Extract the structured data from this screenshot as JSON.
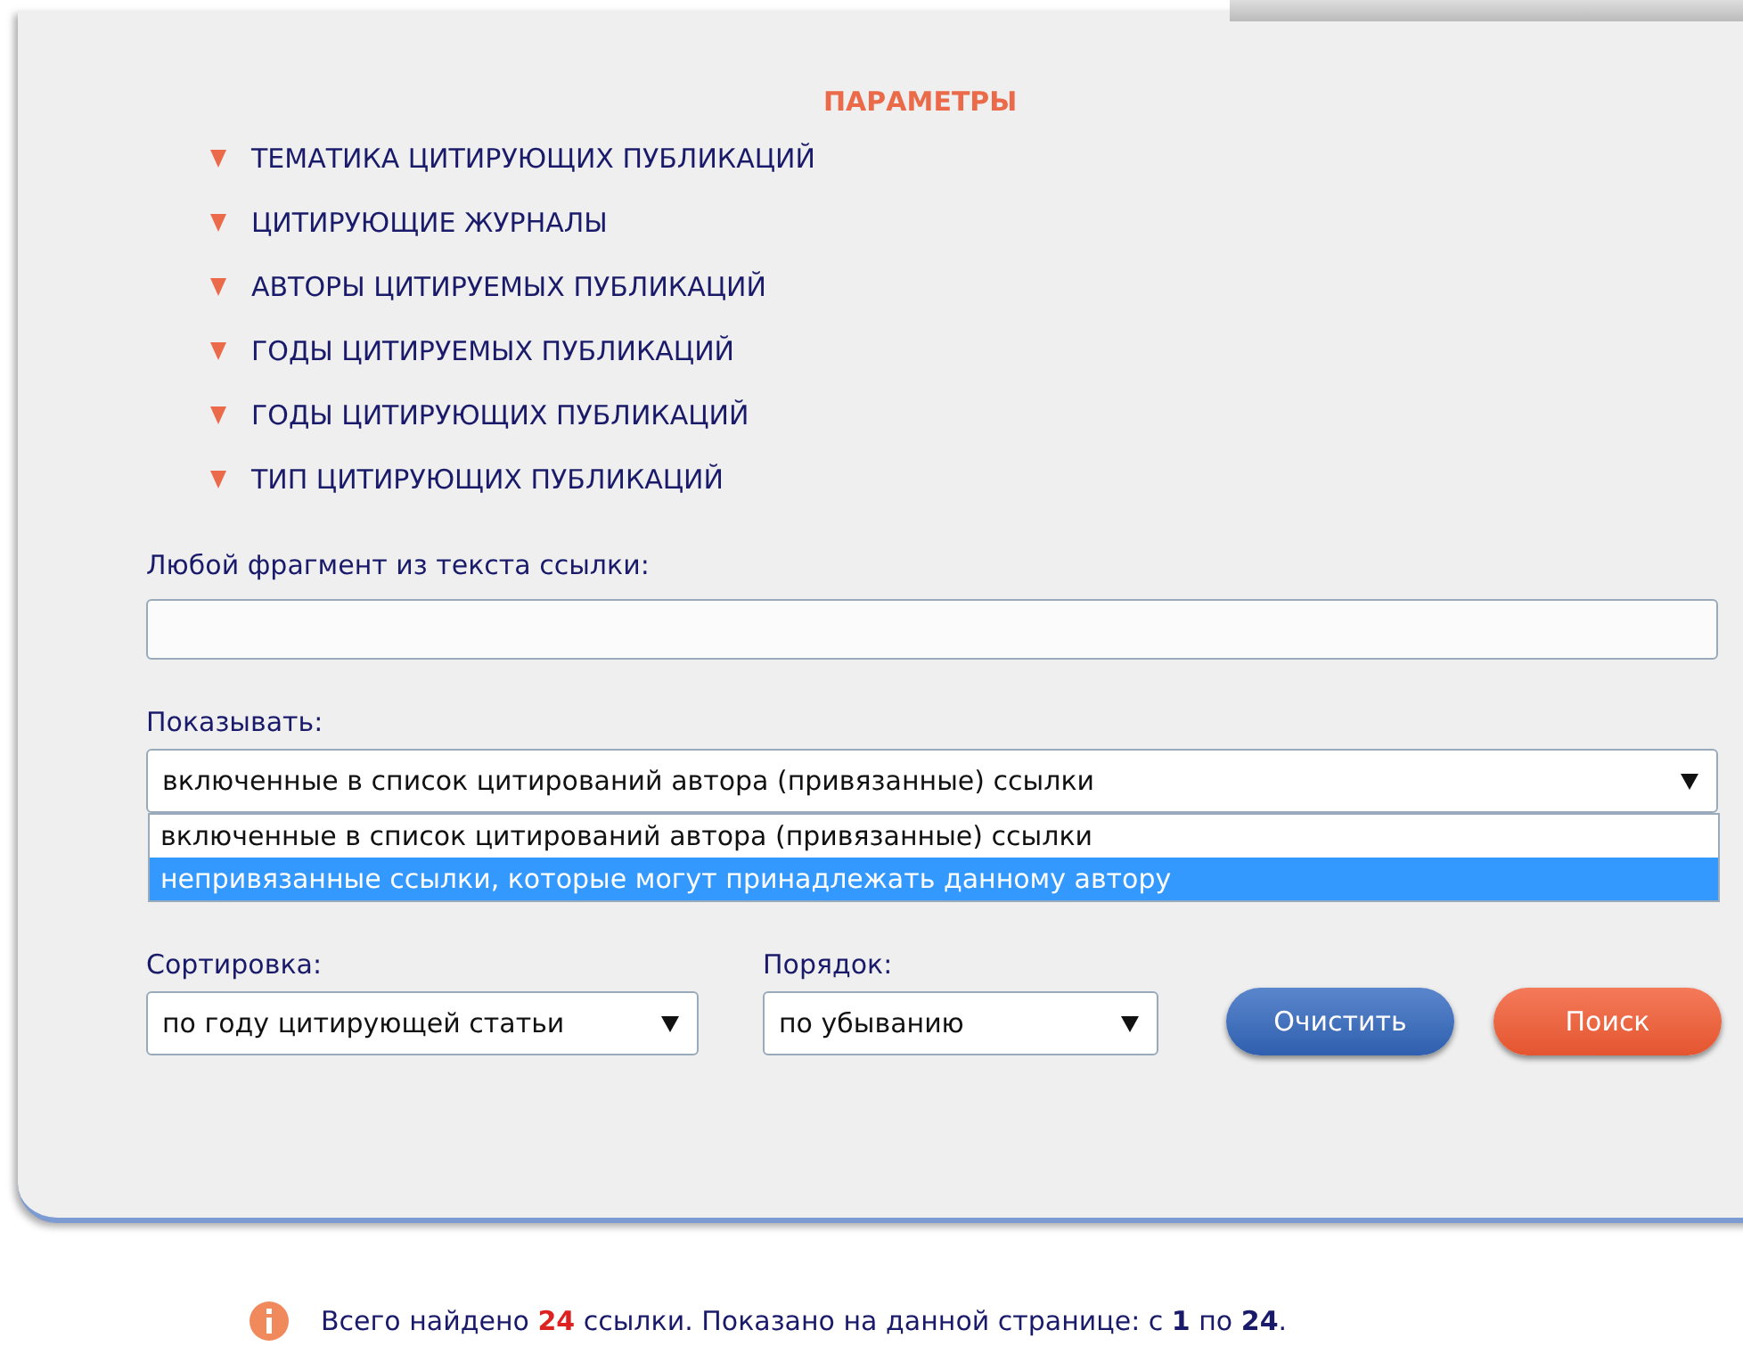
{
  "panel": {
    "title": "ПАРАМЕТРЫ",
    "sections": [
      {
        "label": "ТЕМАТИКА ЦИТИРУЮЩИХ ПУБЛИКАЦИЙ",
        "expanded": false
      },
      {
        "label": "ЦИТИРУЮЩИЕ ЖУРНАЛЫ",
        "expanded": false
      },
      {
        "label": "АВТОРЫ ЦИТИРУЕМЫХ ПУБЛИКАЦИЙ",
        "expanded": false
      },
      {
        "label": "ГОДЫ ЦИТИРУЕМЫХ ПУБЛИКАЦИЙ",
        "expanded": false
      },
      {
        "label": "ГОДЫ ЦИТИРУЮЩИХ ПУБЛИКАЦИЙ",
        "expanded": false
      },
      {
        "label": "ТИП ЦИТИРУЮЩИХ ПУБЛИКАЦИЙ",
        "expanded": false
      }
    ],
    "fragment_field": {
      "label": "Любой фрагмент из текста ссылки:"
    },
    "show_select": {
      "label": "Показывать:",
      "value": "включенные в список цитирований автора (привязанные) ссылки",
      "expanded": true,
      "options": [
        {
          "label": "включенные в список цитирований автора (привязанные) ссылки",
          "highlighted": false
        },
        {
          "label": "непривязанные ссылки, которые могут принадлежать данному автору",
          "highlighted": true
        }
      ]
    },
    "sort_select": {
      "label": "Сортировка:",
      "value": "по году цитирующей статьи"
    },
    "order_select": {
      "label": "Порядок:",
      "value": "по убыванию"
    },
    "buttons": [
      {
        "label": "Очистить",
        "kind": "secondary"
      },
      {
        "label": "Поиск",
        "kind": "primary"
      }
    ]
  },
  "summary": [
    {
      "text": "Всего найдено ",
      "kind": "plain"
    },
    {
      "text": "24",
      "kind": "count"
    },
    {
      "text": " ссылки. Показано на данной странице: с ",
      "kind": "plain"
    },
    {
      "text": "1",
      "kind": "number"
    },
    {
      "text": " по ",
      "kind": "plain"
    },
    {
      "text": "24",
      "kind": "number"
    },
    {
      "text": ".",
      "kind": "plain"
    }
  ]
}
